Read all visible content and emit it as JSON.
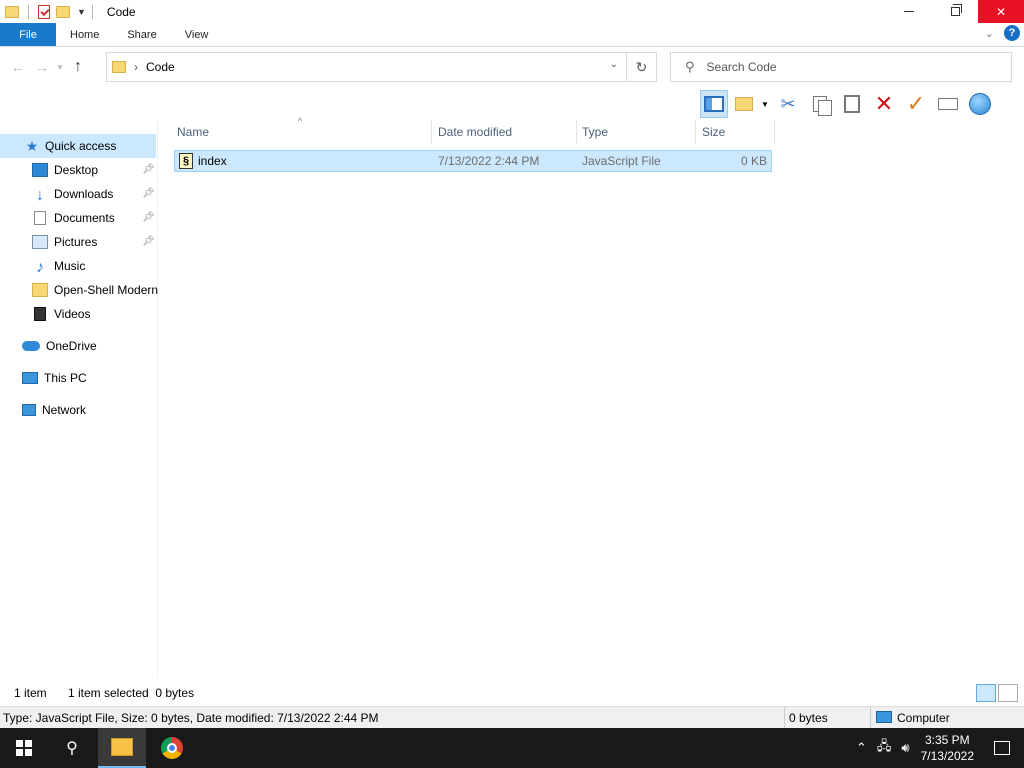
{
  "window": {
    "title": "Code"
  },
  "ribbon": {
    "tabs": [
      "File",
      "Home",
      "Share",
      "View"
    ]
  },
  "address": {
    "path": "Code",
    "search_placeholder": "Search Code"
  },
  "nav": {
    "quick_access": "Quick access",
    "items": [
      {
        "label": "Desktop",
        "icon": "desktop-icon",
        "pinned": true
      },
      {
        "label": "Downloads",
        "icon": "downloads-icon",
        "pinned": true
      },
      {
        "label": "Documents",
        "icon": "documents-icon",
        "pinned": true
      },
      {
        "label": "Pictures",
        "icon": "pictures-icon",
        "pinned": true
      },
      {
        "label": "Music",
        "icon": "music-icon",
        "pinned": false
      },
      {
        "label": "Open-Shell Modern",
        "icon": "folder-icon",
        "pinned": false
      },
      {
        "label": "Videos",
        "icon": "videos-icon",
        "pinned": false
      }
    ],
    "onedrive": "OneDrive",
    "this_pc": "This PC",
    "network": "Network"
  },
  "columns": [
    "Name",
    "Date modified",
    "Type",
    "Size"
  ],
  "files": [
    {
      "name": "index",
      "date_modified": "7/13/2022 2:44 PM",
      "type": "JavaScript File",
      "size": "0 KB",
      "selected": true
    }
  ],
  "status": {
    "item_count": "1 item",
    "selection": "1 item selected  0 bytes"
  },
  "infobar": {
    "details": "Type: JavaScript File, Size: 0 bytes, Date modified: 7/13/2022 2:44 PM",
    "size": "0 bytes",
    "location": "Computer"
  },
  "taskbar": {
    "time": "3:35 PM",
    "date": "7/13/2022"
  },
  "colors": {
    "file_tab": "#1979ca",
    "selection": "#cce8ff",
    "close_button": "#e81123",
    "taskbar": "#1a1a1a"
  }
}
